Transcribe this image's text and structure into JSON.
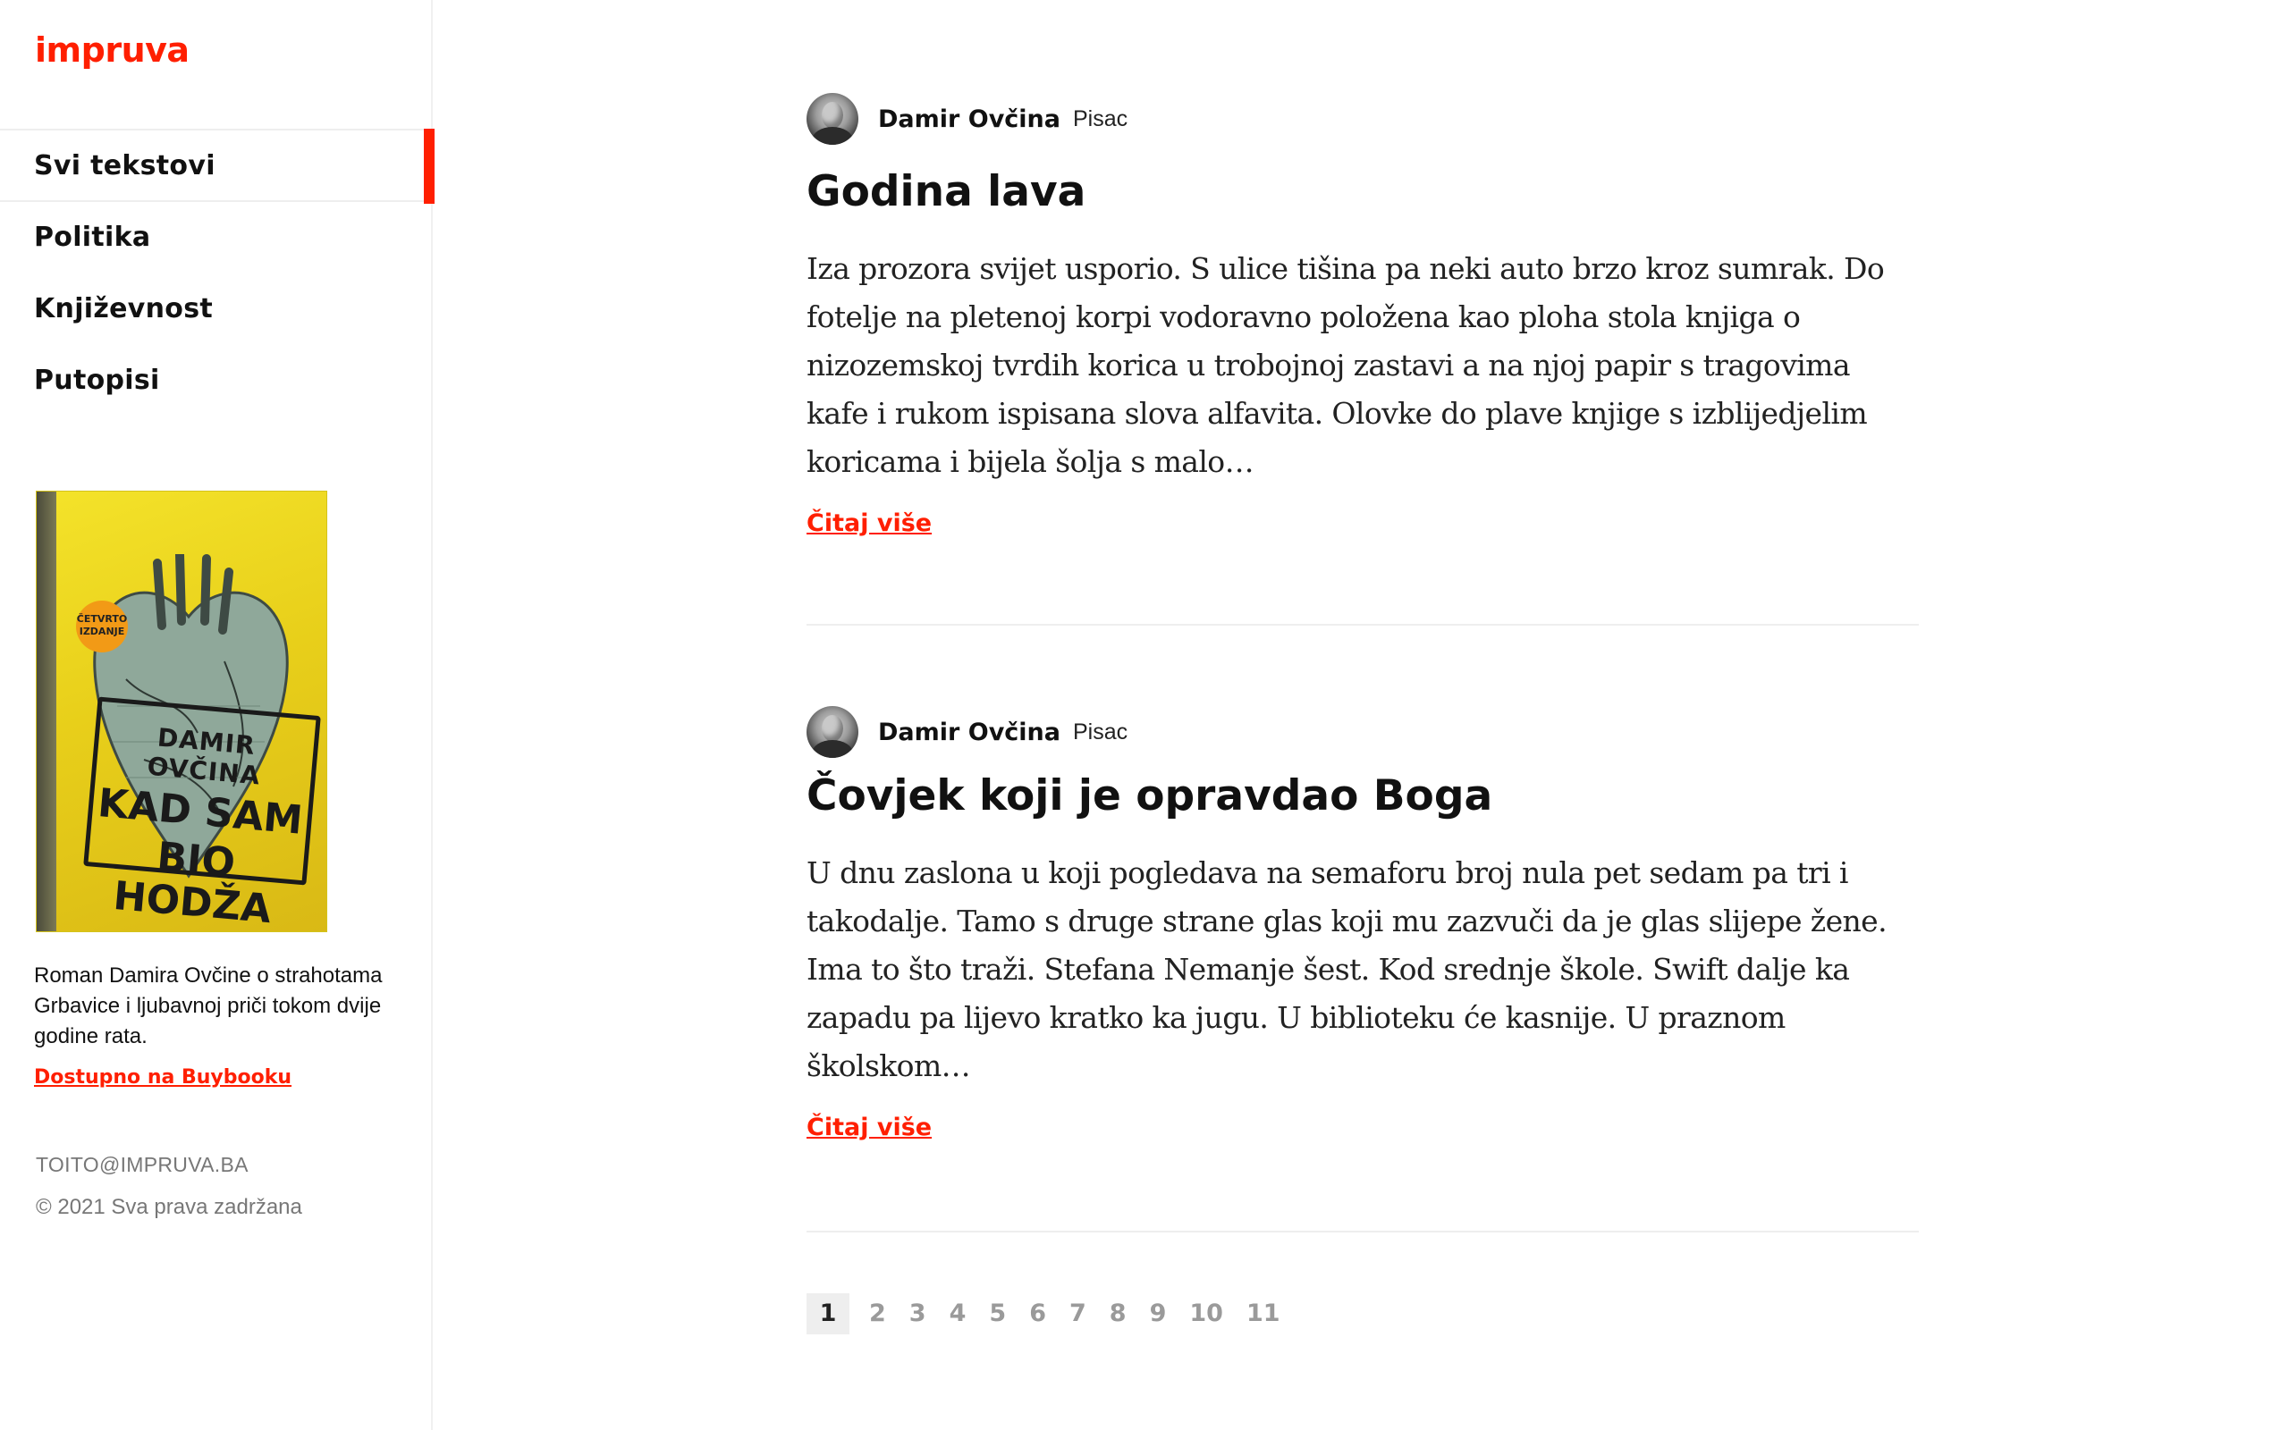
{
  "brand": {
    "logo": "impruva",
    "accent_color": "#ff1f00"
  },
  "nav": {
    "items": [
      {
        "label": "Svi tekstovi",
        "active": true
      },
      {
        "label": "Politika",
        "active": false
      },
      {
        "label": "Književnost",
        "active": false
      },
      {
        "label": "Putopisi",
        "active": false
      }
    ]
  },
  "book": {
    "cover": {
      "author": "DAMIR OVČINA",
      "title_line1": "KAD SAM",
      "title_line2": "BIO HODŽA",
      "badge_line1": "ČETVRTO",
      "badge_line2": "IZDANJE"
    },
    "description": "Roman Damira Ovčine o strahotama Grbavice i ljubavnoj priči tokom dvije godine rata.",
    "link_label": "Dostupno na Buybooku"
  },
  "footer": {
    "email": "TOITO@IMPRUVA.BA",
    "copyright": "© 2021  Sva prava zadržana"
  },
  "posts": [
    {
      "author": "Damir Ovčina",
      "role": "Pisac",
      "title": "Godina lava",
      "excerpt": "Iza prozora svijet usporio. S ulice tišina pa neki auto brzo kroz sumrak. Do fotelje na pletenoj korpi vodoravno položena kao ploha stola knjiga o nizozemskoj tvrdih korica u trobojnoj zastavi a na njoj papir s tragovima kafe i rukom ispisana slova alfavita. Olovke do plave knjige s izblijedjelim koricama i bijela šolja s malo…",
      "read_more": "Čitaj više"
    },
    {
      "author": "Damir Ovčina",
      "role": "Pisac",
      "title": "Čovjek koji je opravdao Boga",
      "excerpt": "U dnu zaslona u koji pogledava na semaforu broj nula pet sedam pa tri i takodalje. Tamo s druge strane glas koji mu zazvuči da je glas slijepe žene. Ima to što traži. Stefana Nemanje šest. Kod srednje škole. Swift dalje ka zapadu pa lijevo kratko ka jugu. U biblioteku će kasnije. U praznom školskom…",
      "read_more": "Čitaj više"
    }
  ],
  "pagination": {
    "current": "1",
    "pages": [
      "1",
      "2",
      "3",
      "4",
      "5",
      "6",
      "7",
      "8",
      "9",
      "10",
      "11"
    ]
  }
}
